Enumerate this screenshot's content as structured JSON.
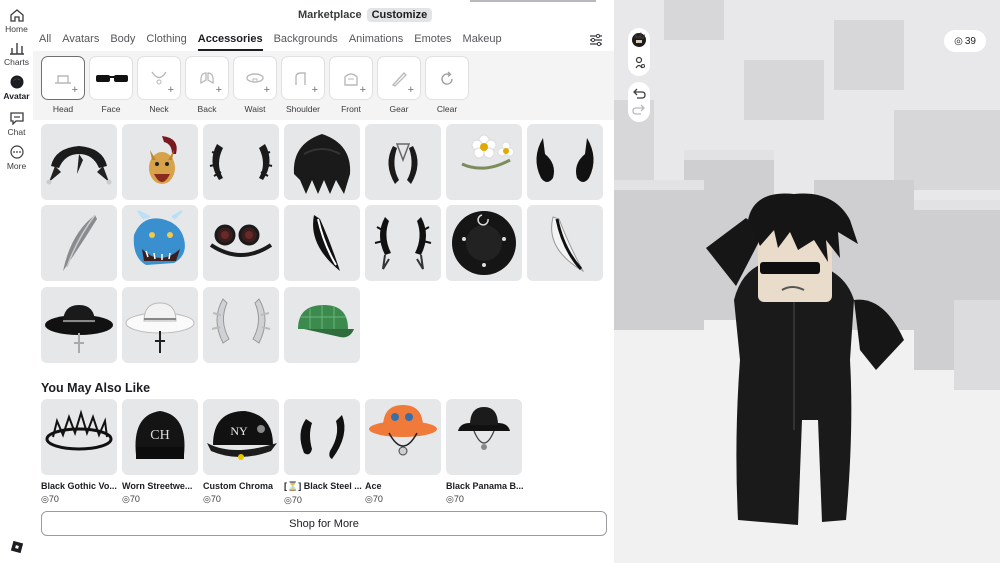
{
  "rail": {
    "items": [
      {
        "label": "Home",
        "icon": "home-icon"
      },
      {
        "label": "Charts",
        "icon": "chart-icon"
      },
      {
        "label": "Avatar",
        "icon": "avatar-icon"
      },
      {
        "label": "Chat",
        "icon": "chat-icon"
      },
      {
        "label": "More",
        "icon": "more-icon"
      }
    ],
    "logo": "roblox-logo-icon"
  },
  "header": {
    "marketplace": "Marketplace",
    "customize": "Customize"
  },
  "categories": [
    "All",
    "Avatars",
    "Body",
    "Clothing",
    "Accessories",
    "Backgrounds",
    "Animations",
    "Emotes",
    "Makeup"
  ],
  "active_category": "Accessories",
  "subcategories": [
    "Head",
    "Face",
    "Neck",
    "Back",
    "Waist",
    "Shoulder",
    "Front",
    "Gear",
    "Clear"
  ],
  "active_subcategory": "Head",
  "equipped_items": [
    {
      "icon": "jester-hat-icon"
    },
    {
      "icon": "fox-mask-icon"
    },
    {
      "icon": "thorn-horns-icon"
    },
    {
      "icon": "black-hair-icon"
    },
    {
      "icon": "small-horns-icon"
    },
    {
      "icon": "daisy-crown-icon"
    },
    {
      "icon": "black-horns-icon"
    },
    {
      "icon": "silver-feather-icon"
    },
    {
      "icon": "dragon-head-icon"
    },
    {
      "icon": "goggles-icon"
    },
    {
      "icon": "black-feather-icon"
    },
    {
      "icon": "spiked-horns-icon"
    },
    {
      "icon": "moon-hat-icon"
    },
    {
      "icon": "white-feather-icon"
    },
    {
      "icon": "black-fedora-icon"
    },
    {
      "icon": "white-fedora-icon"
    },
    {
      "icon": "silver-horns-icon"
    },
    {
      "icon": "green-cap-icon"
    }
  ],
  "recommendations": {
    "title": "You May Also Like",
    "items": [
      {
        "name": "Black Gothic Vo...",
        "price": "70"
      },
      {
        "name": "Worn Streetwe...",
        "price": "70"
      },
      {
        "name": "Custom Chroma",
        "price": "70"
      },
      {
        "name": "[⏳] Black Steel ...",
        "price": "70"
      },
      {
        "name": "Ace",
        "price": "70"
      },
      {
        "name": "Black Panama B...",
        "price": "70"
      }
    ]
  },
  "shop_button": "Shop for More",
  "scene": {
    "robux": "39"
  },
  "colors": {
    "accent": "#1b1d21",
    "panel_bg": "#ffffff",
    "tile_bg": "#e6e7e9",
    "scene_bg": "#e9e9ea"
  }
}
